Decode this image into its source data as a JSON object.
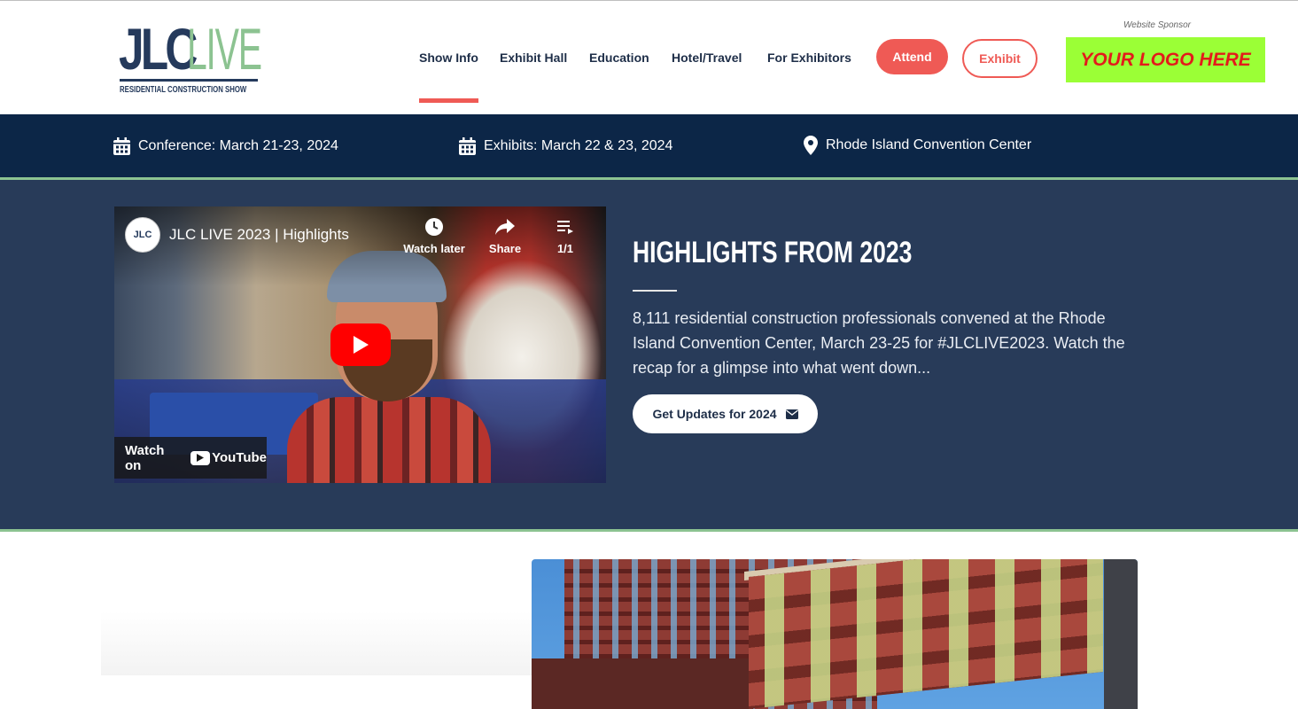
{
  "logo": {
    "brand_a": "JLC",
    "brand_b": "LIVE",
    "tagline": "RESIDENTIAL CONSTRUCTION SHOW"
  },
  "nav": {
    "items": [
      {
        "label": "Show Info",
        "active": true
      },
      {
        "label": "Exhibit Hall"
      },
      {
        "label": "Education"
      },
      {
        "label": "Hotel/Travel"
      },
      {
        "label": "For Exhibitors"
      }
    ],
    "attend_label": "Attend",
    "exhibit_label": "Exhibit"
  },
  "sponsor": {
    "label": "Website Sponsor",
    "logo_text": "YOUR LOGO HERE"
  },
  "infobar": {
    "conference": "Conference: March 21-23, 2024",
    "exhibits": "Exhibits: March 22 & 23, 2024",
    "venue": "Rhode Island Convention Center",
    "icons": [
      "calendar-icon",
      "calendar-icon",
      "map-pin-icon"
    ]
  },
  "video": {
    "title": "JLC LIVE 2023 | Highlights",
    "channel_badge": "JLC",
    "watch_later": "Watch later",
    "share": "Share",
    "playlist_count": "1/1",
    "watch_on": "Watch on",
    "youtube_word": "YouTube"
  },
  "highlights": {
    "title": "HIGHLIGHTS FROM 2023",
    "body": "8,111 residential construction professionals convened at the Rhode Island Convention Center, March 23-25 for #JLCLIVE2023. Watch the recap for a glimpse into what went down...",
    "cta_label": "Get Updates for 2024"
  },
  "colors": {
    "navy": "#0c2647",
    "slate": "#283b59",
    "coral": "#ef5a55",
    "green": "#8cc391",
    "sponsor_bg": "#9bff36",
    "sponsor_text": "#e31b1b"
  }
}
